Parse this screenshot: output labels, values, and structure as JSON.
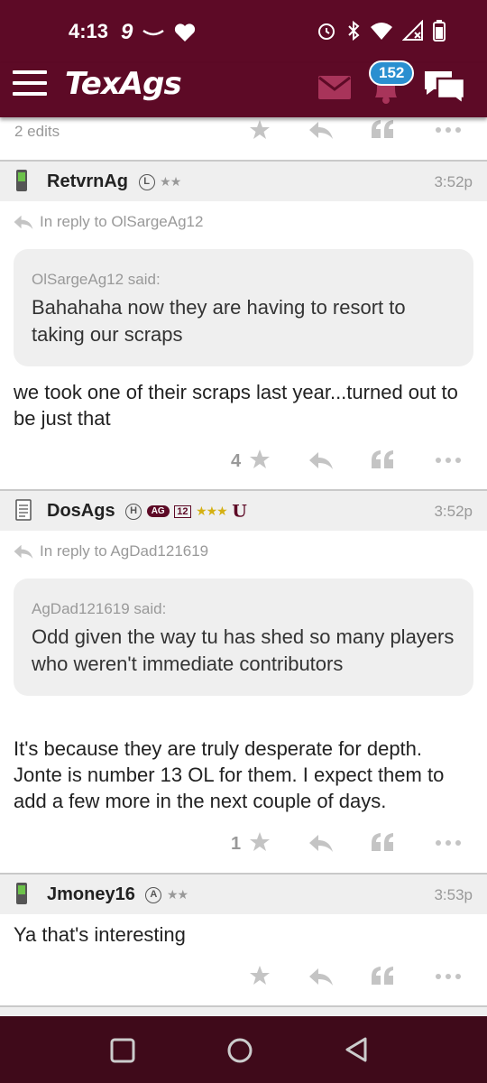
{
  "status_bar": {
    "time": "4:13",
    "carrier_glyph": "9"
  },
  "app": {
    "logo": "TexAgs",
    "notification_count": "152",
    "brand_color": "#5d0a26"
  },
  "top_post": {
    "edits": "2 edits"
  },
  "posts": [
    {
      "username": "RetvrnAg",
      "badges": [
        "L"
      ],
      "stars": "★★",
      "time": "3:52p",
      "reply_to": "In reply to OlSargeAg12",
      "quote_author": "OlSargeAg12 said:",
      "quote_text": "Bahahaha now they are having to resort to taking our scraps",
      "body": "we took one of their scraps last year...turned out to be just that",
      "likes": "4"
    },
    {
      "username": "DosAgs",
      "badges": [
        "H",
        "AG",
        "12"
      ],
      "stars": "★★★",
      "extra_badge": "U",
      "time": "3:52p",
      "reply_to": "In reply to AgDad121619",
      "quote_author": "AgDad121619 said:",
      "quote_text": "Odd given the way tu has shed so many players who weren't immediate contributors",
      "body": "It's because they are truly desperate for depth. Jonte is number 13 OL for them. I expect them to add a few more in the next couple of days.",
      "likes": "1"
    },
    {
      "username": "Jmoney16",
      "badges": [
        "A"
      ],
      "stars": "★★",
      "time": "3:53p",
      "body": "Ya that's interesting",
      "likes": ""
    }
  ]
}
